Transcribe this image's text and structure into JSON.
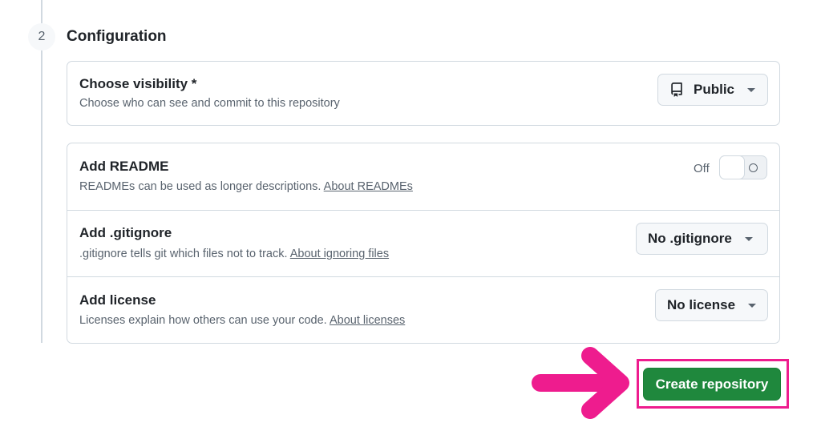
{
  "step": {
    "number": "2",
    "title": "Configuration"
  },
  "visibility": {
    "title": "Choose visibility *",
    "description": "Choose who can see and commit to this repository",
    "selected": "Public",
    "icon": "repo-icon"
  },
  "readme": {
    "title": "Add README",
    "description": "READMEs can be used as longer descriptions.",
    "link": "About READMEs",
    "toggle_label": "Off",
    "toggle_state": "off"
  },
  "gitignore": {
    "title": "Add .gitignore",
    "description": ".gitignore tells git which files not to track.",
    "link": "About ignoring files",
    "selected": "No .gitignore"
  },
  "license": {
    "title": "Add license",
    "description": "Licenses explain how others can use your code.",
    "link": "About licenses",
    "selected": "No license"
  },
  "create_button": {
    "label": "Create repository",
    "color": "#1f883d"
  },
  "annotation": {
    "color": "#ee1c8e",
    "icon": "arrow-right-icon"
  }
}
